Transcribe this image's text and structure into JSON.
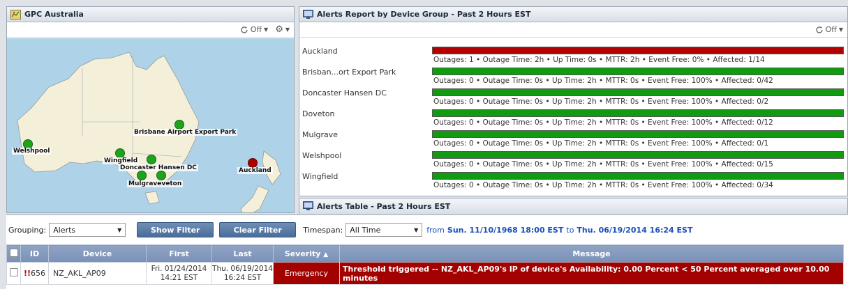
{
  "map_panel": {
    "title": "GPC Australia",
    "refresh_label": "Off",
    "sites": [
      {
        "name": "Welshpool",
        "status": "green"
      },
      {
        "name": "Brisbane Airport Export Park",
        "status": "green"
      },
      {
        "name": "Wingfield",
        "status": "green"
      },
      {
        "name": "Doncaster Hansen DC",
        "status": "green"
      },
      {
        "name": "Mulgrave",
        "status": "green"
      },
      {
        "name": "Doveton",
        "status": "green"
      },
      {
        "name": "Auckland",
        "status": "red"
      }
    ],
    "label_mulgrave_doveton": "Mulgraveveton"
  },
  "report_panel": {
    "title": "Alerts Report by Device Group - Past 2 Hours EST",
    "refresh_label": "Off",
    "rows": [
      {
        "name": "Auckland",
        "color": "#b30000",
        "stats": "Outages: 1 • Outage Time: 2h • Up Time: 0s • MTTR: 2h • Event Free: 0% • Affected: 1/14"
      },
      {
        "name": "Brisban...ort Export Park",
        "color": "#119b11",
        "stats": "Outages: 0 • Outage Time: 0s • Up Time: 2h • MTTR: 0s • Event Free: 100% • Affected: 0/42"
      },
      {
        "name": "Doncaster Hansen DC",
        "color": "#119b11",
        "stats": "Outages: 0 • Outage Time: 0s • Up Time: 2h • MTTR: 0s • Event Free: 100% • Affected: 0/2"
      },
      {
        "name": "Doveton",
        "color": "#119b11",
        "stats": "Outages: 0 • Outage Time: 0s • Up Time: 2h • MTTR: 0s • Event Free: 100% • Affected: 0/12"
      },
      {
        "name": "Mulgrave",
        "color": "#119b11",
        "stats": "Outages: 0 • Outage Time: 0s • Up Time: 2h • MTTR: 0s • Event Free: 100% • Affected: 0/1"
      },
      {
        "name": "Welshpool",
        "color": "#119b11",
        "stats": "Outages: 0 • Outage Time: 0s • Up Time: 2h • MTTR: 0s • Event Free: 100% • Affected: 0/15"
      },
      {
        "name": "Wingfield",
        "color": "#119b11",
        "stats": "Outages: 0 • Outage Time: 0s • Up Time: 2h • MTTR: 0s • Event Free: 100% • Affected: 0/34"
      }
    ]
  },
  "table_panel": {
    "title": "Alerts Table - Past 2 Hours EST"
  },
  "filters": {
    "grouping_label": "Grouping:",
    "grouping_value": "Alerts",
    "show_filter": "Show Filter",
    "clear_filter": "Clear Filter",
    "timespan_label": "Timespan:",
    "timespan_value": "All Time",
    "from_label": "from",
    "from_value": "Sun. 11/10/1968 18:00 EST",
    "to_label": "to",
    "to_value": "Thu. 06/19/2014 16:24 EST"
  },
  "table": {
    "headers": {
      "id": "ID",
      "device": "Device",
      "first": "First",
      "last": "Last",
      "severity": "Severity",
      "message": "Message"
    },
    "rows": [
      {
        "id": "656",
        "device": "NZ_AKL_AP09",
        "first_date": "Fri. 01/24/2014",
        "first_time": "14:21 EST",
        "last_date": "Thu. 06/19/2014",
        "last_time": "16:24 EST",
        "severity": "Emergency",
        "message": "Threshold triggered -- NZ_AKL_AP09's IP of device's Availability: 0.00 Percent < 50 Percent averaged over 10.00 minutes"
      }
    ]
  }
}
